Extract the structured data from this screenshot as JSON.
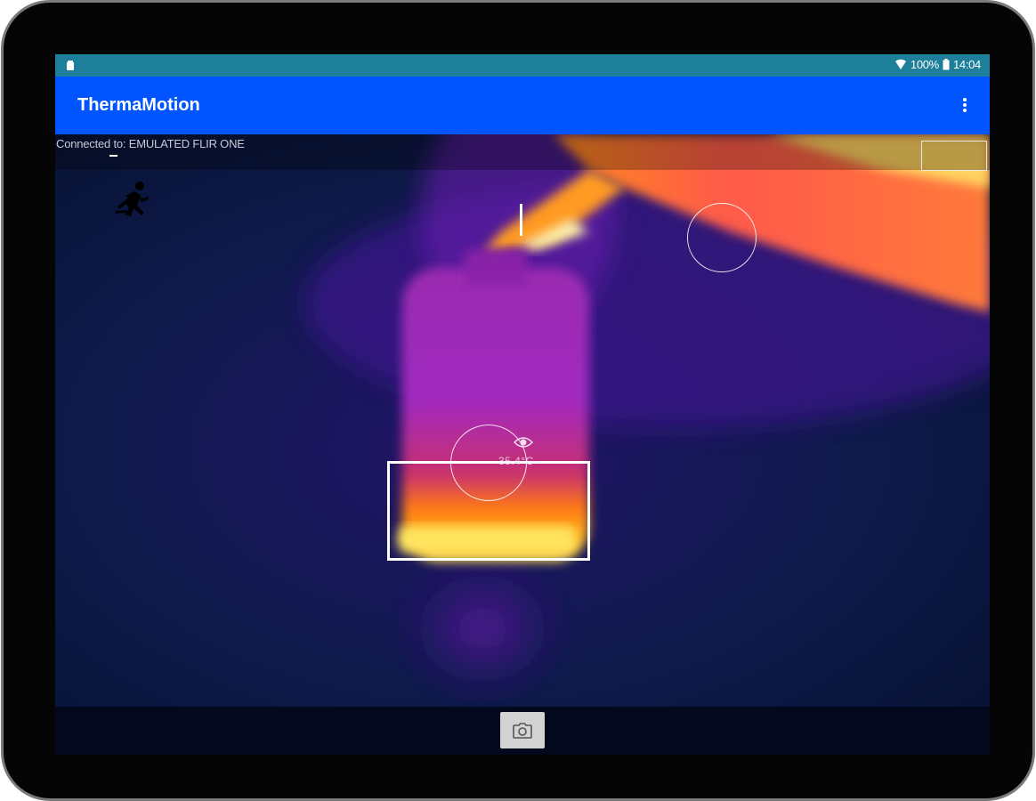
{
  "status_bar": {
    "battery": "100%",
    "time": "14:04",
    "icons": [
      "notification-icon",
      "wifi-icon",
      "battery-icon"
    ]
  },
  "app_bar": {
    "title": "ThermaMotion",
    "menu_icon": "overflow-menu-icon"
  },
  "thermal_view": {
    "connection_status": "Connected to: EMULATED FLIR ONE",
    "motion_icon": "running-person-icon",
    "spot_icon": "spot-meter-icon",
    "spot_temperature": "35.4°C"
  },
  "bottom_bar": {
    "capture_icon": "camera-icon"
  },
  "colors": {
    "status_bar": "#1e7f9a",
    "app_bar": "#0055ff",
    "thermal_cold": "#0b1340",
    "thermal_mid": "#8a1bb8",
    "thermal_hot": "#ffb21e"
  }
}
